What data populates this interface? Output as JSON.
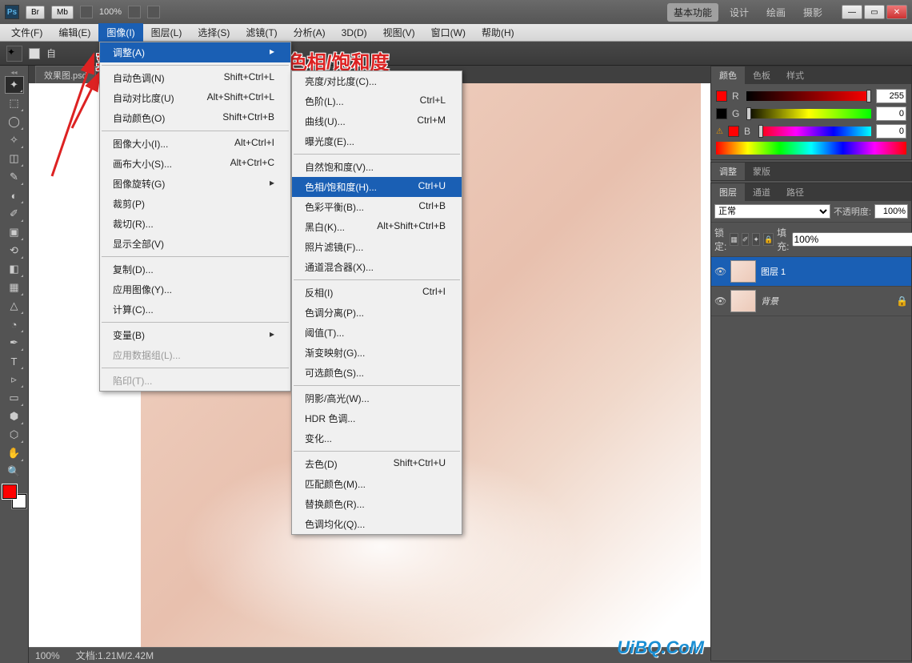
{
  "titlebar": {
    "ps_icon": "Ps",
    "br_btn": "Br",
    "mb_btn": "Mb",
    "zoom": "100%",
    "workspaces": [
      "基本功能",
      "设计",
      "绘画",
      "摄影"
    ]
  },
  "menubar": [
    "文件(F)",
    "编辑(E)",
    "图像(I)",
    "图层(L)",
    "选择(S)",
    "滤镜(T)",
    "分析(A)",
    "3D(D)",
    "视图(V)",
    "窗口(W)",
    "帮助(H)"
  ],
  "optbar": {
    "auto": "自"
  },
  "annotation": "菜单栏---图像---调整---色相/饱和度",
  "doctab": "效果图.psd",
  "statusbar": {
    "zoom": "100%",
    "doc": "文档:1.21M/2.42M"
  },
  "watermark": "UiBQ.CoM",
  "dd1": {
    "adjust": "调整(A)",
    "items1": [
      {
        "l": "自动色调(N)",
        "s": "Shift+Ctrl+L"
      },
      {
        "l": "自动对比度(U)",
        "s": "Alt+Shift+Ctrl+L"
      },
      {
        "l": "自动颜色(O)",
        "s": "Shift+Ctrl+B"
      }
    ],
    "items2": [
      {
        "l": "图像大小(I)...",
        "s": "Alt+Ctrl+I"
      },
      {
        "l": "画布大小(S)...",
        "s": "Alt+Ctrl+C"
      },
      {
        "l": "图像旋转(G)",
        "s": ""
      },
      {
        "l": "裁剪(P)",
        "s": ""
      },
      {
        "l": "裁切(R)...",
        "s": ""
      },
      {
        "l": "显示全部(V)",
        "s": ""
      }
    ],
    "items3": [
      {
        "l": "复制(D)...",
        "s": ""
      },
      {
        "l": "应用图像(Y)...",
        "s": ""
      },
      {
        "l": "计算(C)...",
        "s": ""
      }
    ],
    "items4": [
      {
        "l": "变量(B)",
        "s": ""
      },
      {
        "l": "应用数据组(L)...",
        "s": "",
        "d": true
      }
    ],
    "items5": [
      {
        "l": "陷印(T)...",
        "s": "",
        "d": true
      }
    ]
  },
  "dd2": {
    "g1": [
      {
        "l": "亮度/对比度(C)...",
        "s": ""
      },
      {
        "l": "色阶(L)...",
        "s": "Ctrl+L"
      },
      {
        "l": "曲线(U)...",
        "s": "Ctrl+M"
      },
      {
        "l": "曝光度(E)...",
        "s": ""
      }
    ],
    "g2": [
      {
        "l": "自然饱和度(V)...",
        "s": ""
      },
      {
        "l": "色相/饱和度(H)...",
        "s": "Ctrl+U",
        "hl": true
      },
      {
        "l": "色彩平衡(B)...",
        "s": "Ctrl+B"
      },
      {
        "l": "黑白(K)...",
        "s": "Alt+Shift+Ctrl+B"
      },
      {
        "l": "照片滤镜(F)...",
        "s": ""
      },
      {
        "l": "通道混合器(X)...",
        "s": ""
      }
    ],
    "g3": [
      {
        "l": "反相(I)",
        "s": "Ctrl+I"
      },
      {
        "l": "色调分离(P)...",
        "s": ""
      },
      {
        "l": "阈值(T)...",
        "s": ""
      },
      {
        "l": "渐变映射(G)...",
        "s": ""
      },
      {
        "l": "可选颜色(S)...",
        "s": ""
      }
    ],
    "g4": [
      {
        "l": "阴影/高光(W)...",
        "s": ""
      },
      {
        "l": "HDR 色调...",
        "s": ""
      },
      {
        "l": "变化...",
        "s": ""
      }
    ],
    "g5": [
      {
        "l": "去色(D)",
        "s": "Shift+Ctrl+U"
      },
      {
        "l": "匹配颜色(M)...",
        "s": ""
      },
      {
        "l": "替换颜色(R)...",
        "s": ""
      },
      {
        "l": "色调均化(Q)...",
        "s": ""
      }
    ]
  },
  "panels": {
    "colorTabs": [
      "颜色",
      "色板",
      "样式"
    ],
    "r": "R",
    "g": "G",
    "b": "B",
    "rv": "255",
    "gv": "0",
    "bv": "0",
    "adjTabs": [
      "调整",
      "蒙版"
    ],
    "layerTabs": [
      "图层",
      "通道",
      "路径"
    ],
    "blend": "正常",
    "opLabel": "不透明度:",
    "opVal": "100%",
    "lockLabel": "锁定:",
    "fillLabel": "填充:",
    "fillVal": "100%",
    "layers": [
      {
        "name": "图层 1"
      },
      {
        "name": "背景"
      }
    ]
  }
}
